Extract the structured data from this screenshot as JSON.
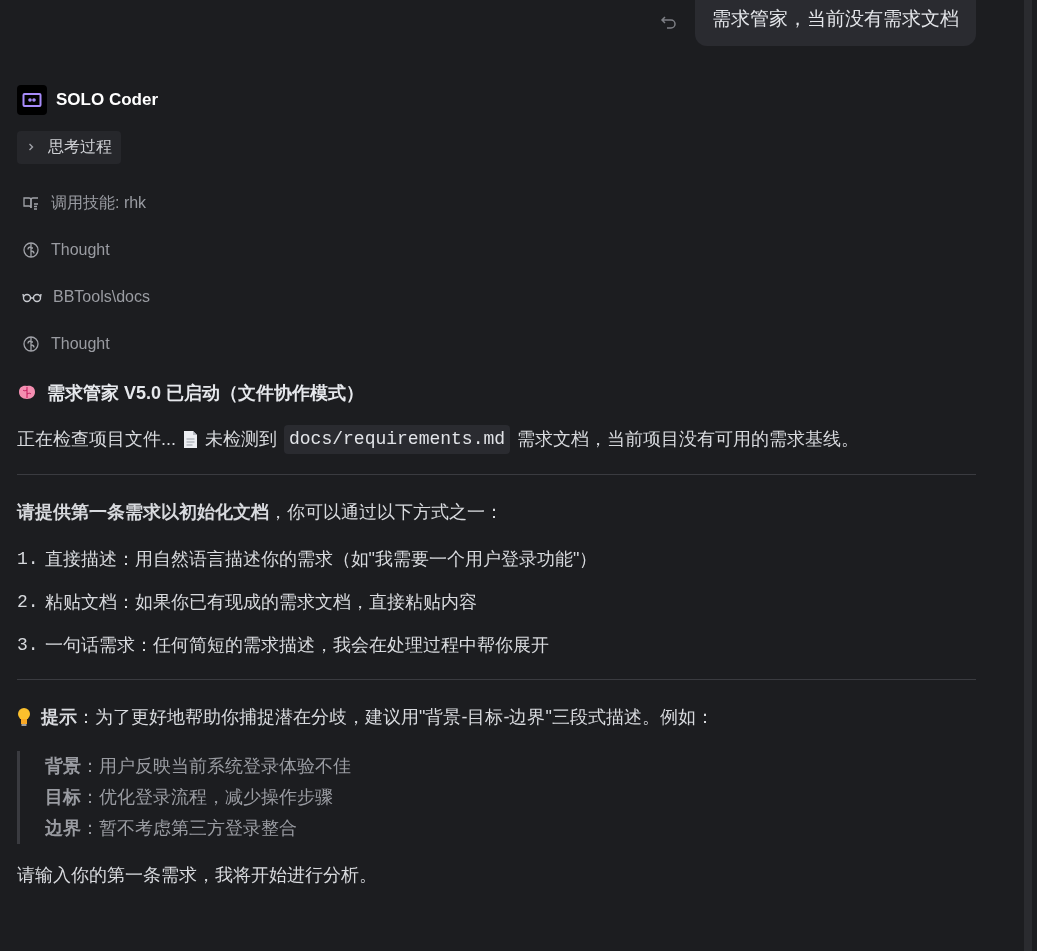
{
  "user_message": {
    "text": "需求管家，当前没有需求文档"
  },
  "assistant": {
    "name": "SOLO Coder"
  },
  "thinking_toggle": {
    "label": "思考过程",
    "expanded": false
  },
  "step_groups": [
    [
      {
        "kind": "skill",
        "text": "调用技能: rhk"
      },
      {
        "kind": "thought",
        "text": "Thought"
      }
    ],
    [
      {
        "kind": "read",
        "text": "BBTools\\docs"
      },
      {
        "kind": "thought",
        "text": "Thought"
      }
    ]
  ],
  "heading": {
    "text": "需求管家 V5.0 已启动（文件协作模式）"
  },
  "status": {
    "before": "正在检查项目文件...",
    "mid": "未检测到",
    "code": "docs/requirements.md",
    "after": "需求文档，当前项目没有可用的需求基线。"
  },
  "prompt": "**请提供第一条需求以初始化文档**，你可以通过以下方式之一：",
  "options": [
    {
      "number": "1.",
      "text": "直接描述：用自然语言描述你的需求（如\"我需要一个用户登录功能\"）"
    },
    {
      "number": "2.",
      "text": "粘贴文档：如果你已有现成的需求文档，直接粘贴内容"
    },
    {
      "number": "3.",
      "text": "一句话需求：任何简短的需求描述，我会在处理过程中帮你展开"
    }
  ],
  "tip": "**提示**：为了更好地帮助你捕捉潜在分歧，建议用\"背景-目标-边界\"三段式描述。例如：",
  "example_lines": [
    "**背景**：用户反映当前系统登录体验不佳",
    "**目标**：优化登录流程，减少操作步骤",
    "**边界**：暂不考虑第三方登录整合"
  ],
  "closing": "请输入你的第一条需求，我将开始进行分析。"
}
